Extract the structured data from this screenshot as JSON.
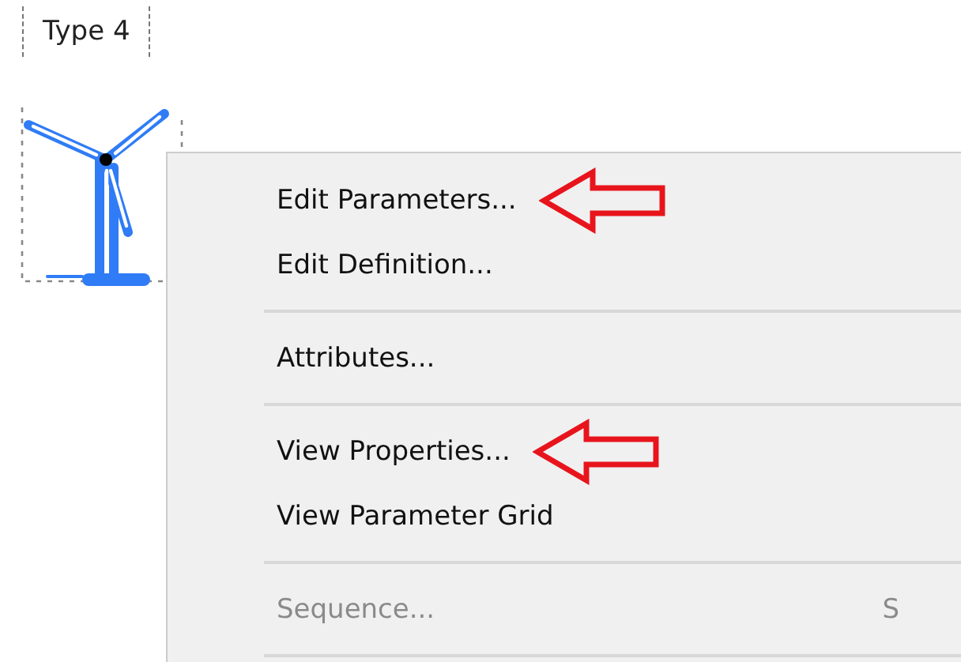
{
  "block": {
    "label": "Type 4"
  },
  "context_menu": {
    "items": [
      {
        "kind": "item",
        "label": "Edit Parameters...",
        "disabled": false,
        "marked": true
      },
      {
        "kind": "item",
        "label": "Edit Definition...",
        "disabled": false,
        "marked": false
      },
      {
        "kind": "separator"
      },
      {
        "kind": "item",
        "label": "Attributes...",
        "disabled": false,
        "marked": false
      },
      {
        "kind": "separator"
      },
      {
        "kind": "item",
        "label": "View Properties...",
        "disabled": false,
        "marked": true
      },
      {
        "kind": "item",
        "label": "View Parameter Grid",
        "disabled": false,
        "marked": false
      },
      {
        "kind": "separator"
      },
      {
        "kind": "item",
        "label": "Sequence...",
        "shortcut": "S",
        "disabled": true,
        "marked": false
      },
      {
        "kind": "separator"
      }
    ]
  }
}
